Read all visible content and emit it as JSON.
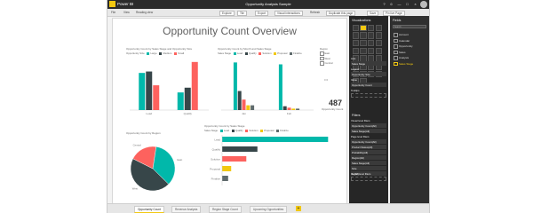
{
  "app": {
    "name": "Power BI",
    "document": "Opportunity Analysis Sample"
  },
  "window_controls": [
    "?",
    "☺",
    "—",
    "□",
    "×"
  ],
  "toolbar": {
    "items": [
      "File",
      "View",
      "Reading view",
      "Explore",
      "Tile",
      "Export",
      "Visual interactions",
      "Refresh",
      "Duplicate this page",
      "Save",
      "Pin live Page"
    ]
  },
  "report": {
    "title": "Opportunity Count Overview",
    "visual1": {
      "title": "Opportunity Count by Sales Stage and Opportunity Size",
      "legend_label": "Opportunity Size",
      "legend": [
        "Large",
        "Medium",
        "Small"
      ]
    },
    "visual2": {
      "title": "Opportunity Count by Month and Sales Stage",
      "legend_label": "Sales Stage",
      "legend": [
        "Lead",
        "Qualify",
        "Solution",
        "Proposal",
        "Finalize"
      ]
    },
    "slicer": {
      "title": "Region",
      "options": [
        "East",
        "West",
        "Central"
      ]
    },
    "card": {
      "value": "487",
      "label": "Opportunity Count"
    },
    "visual3": {
      "title": "Opportunity Count by Region"
    },
    "visual4": {
      "title": "Opportunity Count by Sales Stage",
      "legend_label": "Sales Stage",
      "legend": [
        "Lead",
        "Qualify",
        "Solution",
        "Proposal",
        "Finalize"
      ]
    }
  },
  "tabs": [
    "Opportunity Count",
    "Revenue Analysis",
    "Region Stage Count",
    "Upcoming Opportunities"
  ],
  "add_tab": "+",
  "visualizations_pane": {
    "title": "Visualizations",
    "wells": [
      {
        "head": "Axis",
        "items": [
          "Sales Stage"
        ]
      },
      {
        "head": "Legend",
        "items": [
          "Opportunity Size"
        ]
      },
      {
        "head": "Value",
        "items": [
          "Opportunity Count"
        ]
      },
      {
        "head": "Tooltips",
        "items": []
      }
    ],
    "filters_title": "Filters",
    "filters": [
      {
        "head": "Visual level filters",
        "items": [
          "Opportunity Count(All)",
          "Sales Stage(All)"
        ]
      },
      {
        "head": "Page level filters",
        "items": [
          "Opportunity Count(All)",
          "Product Status(All)",
          "Probability(All)",
          "Region(All)",
          "Sales Stage(All)",
          "Size",
          "is (All)"
        ]
      },
      {
        "head": "Report level filters",
        "items": []
      }
    ]
  },
  "fields_pane": {
    "title": "Fields",
    "search_placeholder": "Search",
    "fields": [
      "Account",
      "Calendar",
      "Opportunity",
      "Sales",
      "Analysis",
      "Sales Stage"
    ]
  },
  "colors": {
    "teal": "#01b8aa",
    "dark": "#374649",
    "red": "#fd625e",
    "yellow": "#f2c80f",
    "gray": "#5f6b6d",
    "accent": "#f2c811"
  },
  "chart_data": [
    {
      "type": "bar",
      "categories": [
        "Lead",
        "Qualify"
      ],
      "series": [
        {
          "name": "Large",
          "values": [
            78,
            37
          ]
        },
        {
          "name": "Medium",
          "values": [
            81,
            47
          ]
        },
        {
          "name": "Small",
          "values": [
            52,
            101
          ]
        }
      ],
      "ylim": [
        0,
        110
      ]
    },
    {
      "type": "bar",
      "categories": [
        "Jan",
        "Feb"
      ],
      "series": [
        {
          "name": "Lead",
          "values": [
            100,
            96
          ]
        },
        {
          "name": "Qualify",
          "values": [
            40,
            8
          ]
        },
        {
          "name": "Solution",
          "values": [
            22,
            5
          ]
        },
        {
          "name": "Proposal",
          "values": [
            10,
            3
          ]
        },
        {
          "name": "Finalize",
          "values": [
            10,
            3
          ]
        }
      ],
      "ylim": [
        0,
        110
      ]
    },
    {
      "type": "pie",
      "categories": [
        "East",
        "West",
        "Central"
      ],
      "values": [
        35,
        45,
        20
      ]
    },
    {
      "type": "bar",
      "orientation": "horizontal",
      "categories": [
        "Lead",
        "Qualify",
        "Solution",
        "Proposal",
        "Finalize"
      ],
      "values": [
        210,
        70,
        48,
        18,
        12
      ],
      "xlim": [
        0,
        220
      ]
    }
  ]
}
